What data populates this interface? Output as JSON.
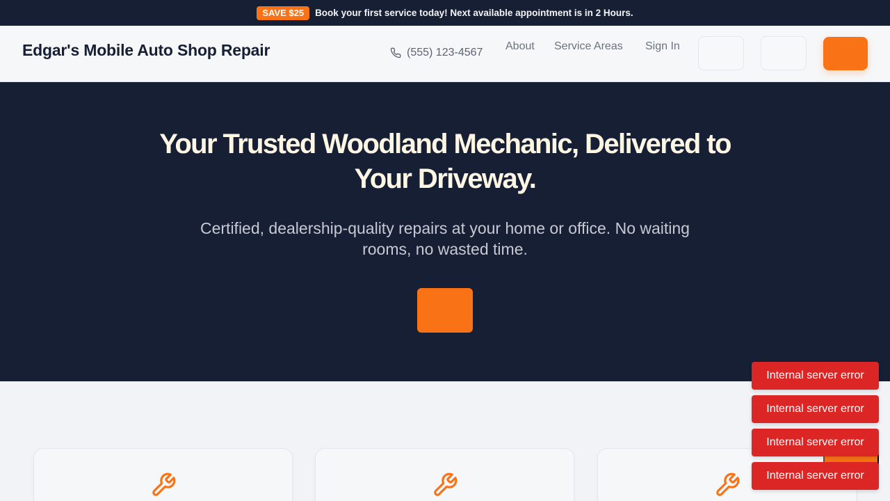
{
  "promo": {
    "badge": "SAVE $25",
    "text": "Book your first service today! Next available appointment is in 2 Hours."
  },
  "header": {
    "logo": "Edgar's Mobile Auto Shop Repair",
    "phone": "(555) 123-4567",
    "nav": [
      "About",
      "Service Areas",
      "Sign In"
    ]
  },
  "hero": {
    "title": "Your Trusted Woodland Mechanic, Delivered to Your Driveway.",
    "subtitle": "Certified, dealership-quality repairs at your home or office. No waiting rooms, no wasted time."
  },
  "services": [
    {
      "icon": "wrench-icon"
    },
    {
      "icon": "wrench-icon"
    },
    {
      "icon": "wrench-icon"
    }
  ],
  "toasts": [
    "Internal server error",
    "Internal server error",
    "Internal server error",
    "Internal server error"
  ],
  "colors": {
    "navy": "#171f35",
    "accent": "#f97316",
    "error": "#dc2626"
  }
}
